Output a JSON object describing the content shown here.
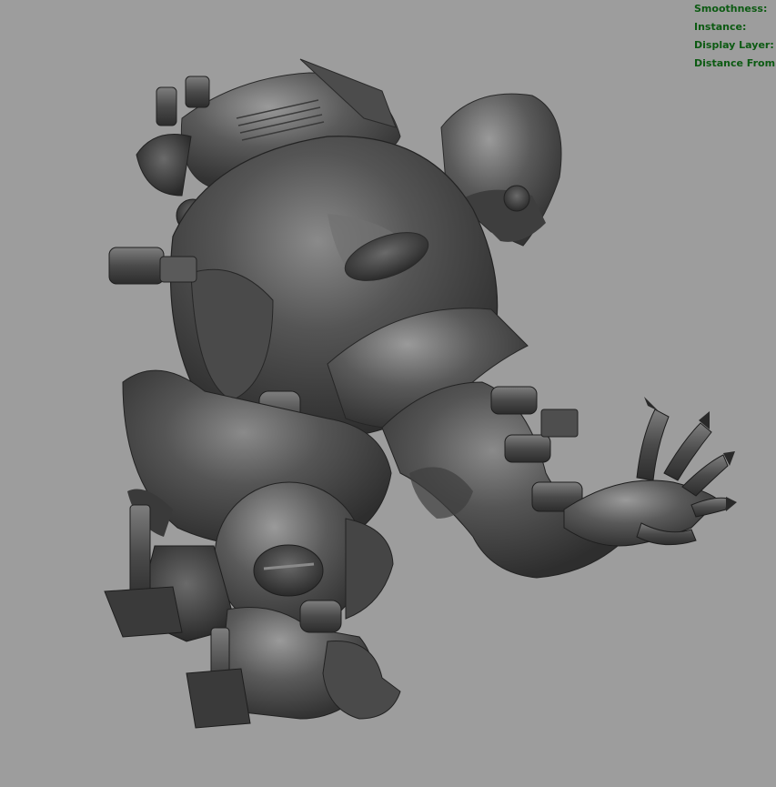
{
  "hud": {
    "smoothness_label": "Smoothness:",
    "instance_label": "Instance:",
    "display_layer_label": "Display Layer:",
    "distance_label": "Distance From C"
  },
  "colors": {
    "viewport_background": "#9d9d9d",
    "hud_text": "#0c5a12",
    "model_base": "#4a4a4a"
  }
}
